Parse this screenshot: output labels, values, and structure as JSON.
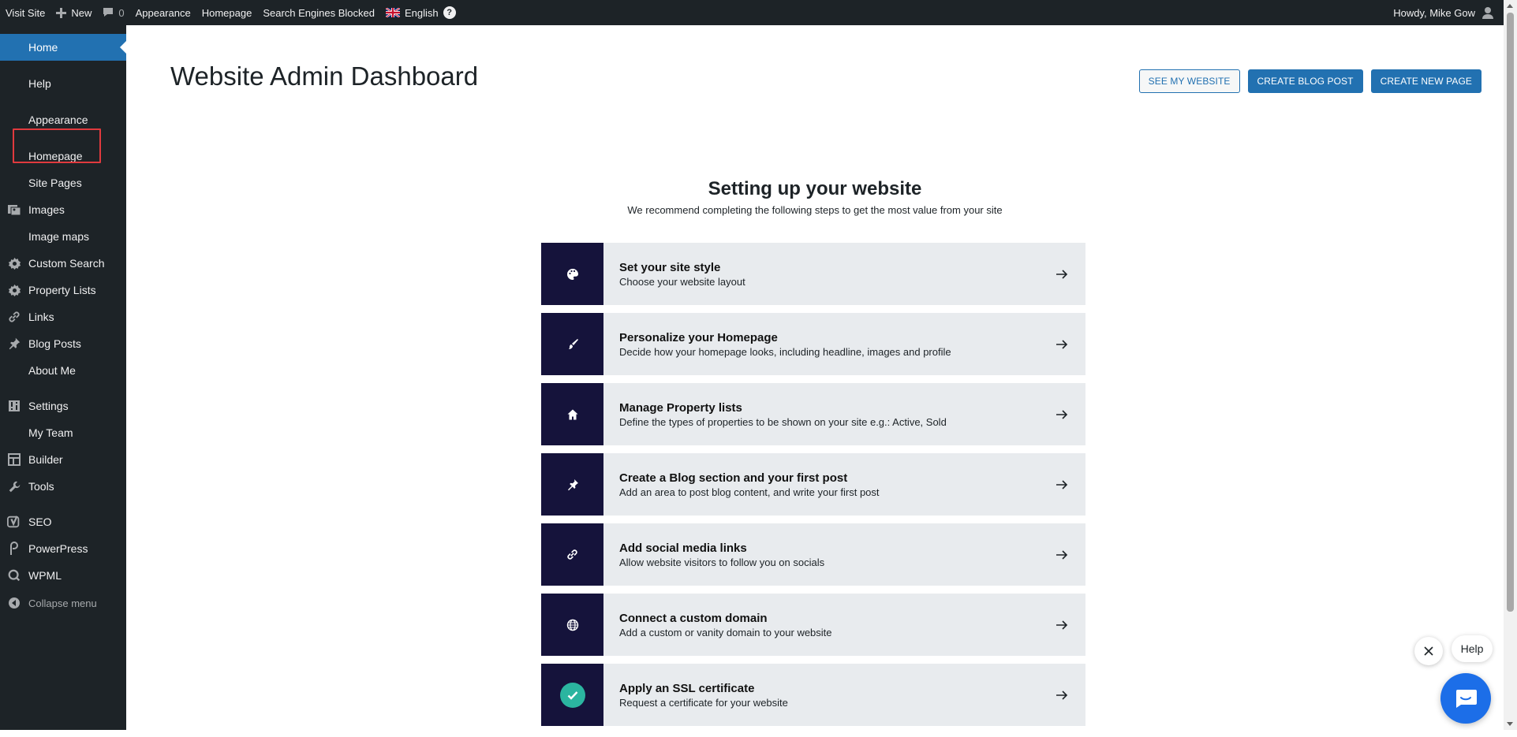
{
  "adminbar": {
    "visit_site": "Visit Site",
    "new": "New",
    "comments_count": "0",
    "appearance": "Appearance",
    "homepage": "Homepage",
    "search_engines": "Search Engines Blocked",
    "language": "English",
    "help_glyph": "?",
    "howdy": "Howdy, Mike Gow"
  },
  "sidebar": {
    "items": [
      {
        "label": "Home",
        "icon": "home-icon"
      },
      {
        "label": "Help",
        "icon": ""
      },
      {
        "label": "Appearance",
        "icon": ""
      },
      {
        "label": "Homepage",
        "icon": ""
      },
      {
        "label": "Site Pages",
        "icon": ""
      },
      {
        "label": "Images",
        "icon": "images-icon"
      },
      {
        "label": "Image maps",
        "icon": ""
      },
      {
        "label": "Custom Search",
        "icon": "gear-icon"
      },
      {
        "label": "Property Lists",
        "icon": "gear-icon"
      },
      {
        "label": "Links",
        "icon": "link-icon"
      },
      {
        "label": "Blog Posts",
        "icon": "pin-icon"
      },
      {
        "label": "About Me",
        "icon": ""
      },
      {
        "label": "Settings",
        "icon": "settings-icon"
      },
      {
        "label": "My Team",
        "icon": ""
      },
      {
        "label": "Builder",
        "icon": "builder-icon"
      },
      {
        "label": "Tools",
        "icon": "wrench-icon"
      },
      {
        "label": "SEO",
        "icon": "seo-icon"
      },
      {
        "label": "PowerPress",
        "icon": "podcast-icon"
      },
      {
        "label": "WPML",
        "icon": "wpml-icon"
      },
      {
        "label": "Collapse menu",
        "icon": "collapse-icon"
      }
    ]
  },
  "main": {
    "title": "Website Admin Dashboard",
    "buttons": {
      "see_website": "SEE MY WEBSITE",
      "create_blog": "CREATE BLOG POST",
      "create_page": "CREATE NEW PAGE"
    },
    "setup_title": "Setting up your website",
    "setup_subtitle": "We recommend completing the following steps to get the most value from your site",
    "steps": [
      {
        "title": "Set your site style",
        "desc": "Choose your website layout",
        "icon": "palette-icon"
      },
      {
        "title": "Personalize your Homepage",
        "desc": "Decide how your homepage looks, including headline, images and profile",
        "icon": "brush-icon"
      },
      {
        "title": "Manage Property lists",
        "desc": "Define the types of properties to be shown on your site e.g.: Active, Sold",
        "icon": "house-icon"
      },
      {
        "title": "Create a Blog section and your first post",
        "desc": "Add an area to post blog content, and write your first post",
        "icon": "pin-icon"
      },
      {
        "title": "Add social media links",
        "desc": "Allow website visitors to follow you on socials",
        "icon": "link-icon"
      },
      {
        "title": "Connect a custom domain",
        "desc": "Add a custom or vanity domain to your website",
        "icon": "globe-icon"
      },
      {
        "title": "Apply an SSL certificate",
        "desc": "Request a certificate for your website",
        "icon": "check-circle-icon"
      }
    ]
  },
  "help_widget": {
    "label": "Help"
  },
  "colors": {
    "admin_bg": "#1d2327",
    "accent": "#2271b1",
    "step_icon_bg": "#15133b",
    "step_bg": "#e8ebee",
    "ssl_check": "#2bb5a0",
    "help_fab": "#1c6ee8"
  }
}
